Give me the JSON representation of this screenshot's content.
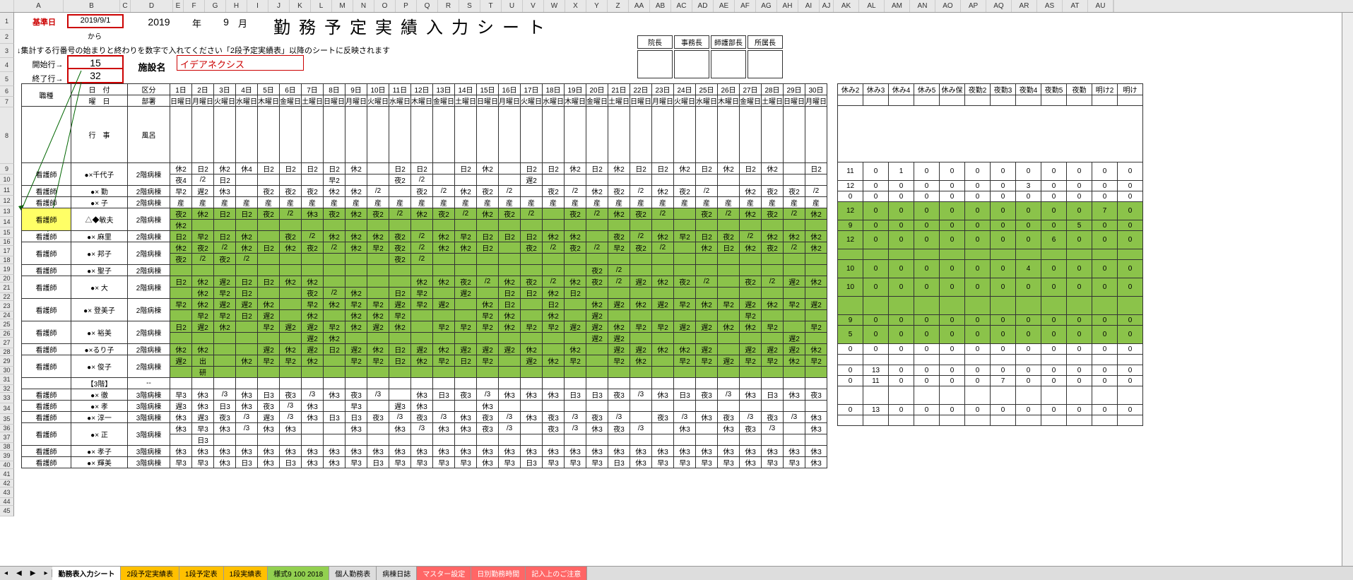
{
  "cols": [
    "A",
    "B",
    "C",
    "D",
    "E",
    "F",
    "G",
    "H",
    "I",
    "J",
    "K",
    "L",
    "M",
    "N",
    "O",
    "P",
    "Q",
    "R",
    "S",
    "T",
    "U",
    "V",
    "W",
    "X",
    "Y",
    "Z",
    "AA",
    "AB",
    "AC",
    "AD",
    "AE",
    "AF",
    "AG",
    "AH",
    "AI",
    "AJ",
    "AK",
    "AL",
    "AM",
    "AN",
    "AO",
    "AP",
    "AQ",
    "AR",
    "AS",
    "AT",
    "AU"
  ],
  "rows": [
    "1",
    "2",
    "3",
    "4",
    "5",
    "6",
    "7",
    "8",
    "9",
    "10",
    "11",
    "12",
    "13",
    "14",
    "15",
    "16",
    "17",
    "18",
    "19",
    "20",
    "21",
    "22",
    "23",
    "24",
    "25",
    "26",
    "27",
    "28",
    "29",
    "30",
    "31",
    "32",
    "33",
    "34",
    "35",
    "36",
    "37",
    "38",
    "39",
    "40",
    "41",
    "42",
    "43",
    "44",
    "45"
  ],
  "header": {
    "base_label": "基準日",
    "base_date": "2019/9/1",
    "year": "2019",
    "year_suf": "年",
    "month": "9",
    "month_suf": "月",
    "title": "勤務予定実績入力シート",
    "from": "から",
    "note": "↓集計する行番号の始まりと終わりを数字で入れてください「2段予定実績表」以降のシートに反映されます",
    "start_label": "開始行→",
    "start_val": "15",
    "end_label": "終了行→",
    "end_val": "32",
    "facility_label": "施設名",
    "facility_name": "イデアネクシス",
    "approvals": [
      "院長",
      "事務長",
      "師護部長",
      "所属長"
    ]
  },
  "gridhdr": {
    "job": "職種",
    "date": "日　付",
    "kubun": "区分",
    "dow": "曜　日",
    "busho": "部署",
    "event": "行　事",
    "bath": "風呂",
    "days": [
      "1日",
      "2日",
      "3日",
      "4日",
      "5日",
      "6日",
      "7日",
      "8日",
      "9日",
      "10日",
      "11日",
      "12日",
      "13日",
      "14日",
      "15日",
      "16日",
      "17日",
      "18日",
      "19日",
      "20日",
      "21日",
      "22日",
      "23日",
      "24日",
      "25日",
      "26日",
      "27日",
      "28日",
      "29日",
      "30日"
    ],
    "dows": [
      "日曜日",
      "月曜日",
      "火曜日",
      "水曜日",
      "木曜日",
      "金曜日",
      "土曜日",
      "日曜日",
      "月曜日",
      "火曜日",
      "水曜日",
      "木曜日",
      "金曜日",
      "土曜日",
      "日曜日",
      "月曜日",
      "火曜日",
      "水曜日",
      "木曜日",
      "金曜日",
      "土曜日",
      "日曜日",
      "月曜日",
      "火曜日",
      "水曜日",
      "木曜日",
      "金曜日",
      "土曜日",
      "日曜日",
      "月曜日"
    ]
  },
  "sumhdr": [
    "休み2",
    "休み3",
    "休み4",
    "休み5",
    "休み保",
    "夜勤2",
    "夜勤3",
    "夜勤4",
    "夜勤5",
    "夜勤",
    "明け2",
    "明け"
  ],
  "staff": [
    {
      "job": "看護師",
      "name": "●×千代子",
      "ward": "2階病棟",
      "g": 0,
      "r1": [
        "休2",
        "日2",
        "休2",
        "休4",
        "日2",
        "日2",
        "日2",
        "日2",
        "休2",
        "",
        "日2",
        "日2",
        "",
        "日2",
        "休2",
        "",
        "日2",
        "日2",
        "休2",
        "日2",
        "休2",
        "日2",
        "日2",
        "休2",
        "日2",
        "休2",
        "日2",
        "休2",
        "",
        "日2"
      ],
      "r2": [
        "夜4",
        "/2",
        "日2",
        "",
        "",
        "",
        "",
        "早2",
        "",
        "",
        "夜2",
        "/2",
        "",
        "",
        "",
        "",
        "遅2",
        "",
        "",
        "",
        "",
        "",
        "",
        "",
        "",
        "",
        "",
        "",
        "",
        ""
      ],
      "sum": [
        11,
        0,
        1,
        0,
        0,
        0,
        0,
        0,
        0,
        0,
        0,
        0
      ]
    },
    {
      "job": "看護師",
      "name": "●× 勤",
      "ward": "2階病棟",
      "g": 0,
      "r1": [
        "早2",
        "遅2",
        "休3",
        "",
        "夜2",
        "夜2",
        "夜2",
        "休2",
        "休2",
        "/2",
        "",
        "夜2",
        "/2",
        "休2",
        "夜2",
        "/2",
        "",
        "夜2",
        "/2",
        "休2",
        "夜2",
        "/2",
        "休2",
        "夜2",
        "/2",
        "",
        "休2",
        "夜2",
        "夜2",
        "/2"
      ],
      "r2": [],
      "sum": [
        12,
        0,
        0,
        0,
        0,
        0,
        0,
        3,
        0,
        0,
        0,
        0
      ]
    },
    {
      "job": "看護師",
      "name": "●× 子",
      "ward": "2階病棟",
      "g": 0,
      "r1": [
        "産",
        "産",
        "産",
        "産",
        "産",
        "産",
        "産",
        "産",
        "産",
        "産",
        "産",
        "産",
        "産",
        "産",
        "産",
        "産",
        "産",
        "産",
        "産",
        "産",
        "産",
        "産",
        "産",
        "産",
        "産",
        "産",
        "産",
        "産",
        "産",
        "産"
      ],
      "r2": [],
      "sum": [
        0,
        0,
        0,
        0,
        0,
        0,
        0,
        0,
        0,
        0,
        0,
        0
      ]
    },
    {
      "job": "看護師",
      "name": "△◆敏夫",
      "ward": "2階病棟",
      "g": 1,
      "hl": 1,
      "r1": [
        "夜2",
        "休2",
        "日2",
        "日2",
        "夜2",
        "/2",
        "休3",
        "夜2",
        "休2",
        "夜2",
        "/2",
        "休2",
        "夜2",
        "/2",
        "休2",
        "夜2",
        "/2",
        "",
        "夜2",
        "/2",
        "休2",
        "夜2",
        "/2",
        "",
        "夜2",
        "/2",
        "休2",
        "夜2",
        "/2",
        "休2"
      ],
      "r2": [
        "休2",
        "",
        "",
        "",
        "",
        "",
        "",
        "",
        "",
        "",
        "",
        "",
        "",
        "",
        "",
        "",
        "",
        "",
        "",
        "",
        "",
        "",
        "",
        "",
        "",
        "",
        "",
        "",
        "",
        ""
      ],
      "sum": [
        12,
        0,
        0,
        0,
        0,
        0,
        0,
        0,
        0,
        0,
        7,
        0
      ]
    },
    {
      "job": "看護師",
      "name": "●× 麻里",
      "ward": "2階病棟",
      "g": 1,
      "r1": [
        "日2",
        "早2",
        "日2",
        "休2",
        "",
        "夜2",
        "/2",
        "休2",
        "休2",
        "休2",
        "夜2",
        "/2",
        "休2",
        "早2",
        "日2",
        "日2",
        "日2",
        "休2",
        "休2",
        "",
        "夜2",
        "/2",
        "休2",
        "早2",
        "日2",
        "夜2",
        "/2",
        "休2",
        "休2",
        "休2"
      ],
      "r2": [],
      "sum": [
        9,
        0,
        0,
        0,
        0,
        0,
        0,
        0,
        0,
        5,
        0,
        0
      ]
    },
    {
      "job": "看護師",
      "name": "●× 邦子",
      "ward": "2階病棟",
      "g": 1,
      "r1": [
        "休2",
        "夜2",
        "/2",
        "休2",
        "日2",
        "休2",
        "夜2",
        "/2",
        "休2",
        "早2",
        "夜2",
        "/2",
        "休2",
        "休2",
        "日2",
        "",
        "夜2",
        "/2",
        "夜2",
        "/2",
        "早2",
        "夜2",
        "/2",
        "",
        "休2",
        "日2",
        "休2",
        "夜2",
        "/2",
        "休2"
      ],
      "r2": [
        "夜2",
        "/2",
        "夜2",
        "/2",
        "",
        "",
        "",
        "",
        "",
        "",
        "夜2",
        "/2",
        "",
        "",
        "",
        "",
        "",
        "",
        "",
        "",
        "",
        "",
        "",
        "",
        "",
        "",
        "",
        "",
        "",
        ""
      ],
      "sum": [
        12,
        0,
        0,
        0,
        0,
        0,
        0,
        0,
        6,
        0,
        0,
        0
      ]
    },
    {
      "job": "看護師",
      "name": "●× 聖子",
      "ward": "2階病棟",
      "g": 1,
      "r1": [
        "",
        "",
        "",
        "",
        "",
        "",
        "",
        "",
        "",
        "",
        "",
        "",
        "",
        "",
        "",
        "",
        "",
        "",
        "",
        "夜2",
        "/2",
        "",
        "",
        "",
        "",
        "",
        "",
        "",
        "",
        ""
      ],
      "r2": [],
      "sum": []
    },
    {
      "job": "看護師",
      "name": "●× 大",
      "ward": "2階病棟",
      "g": 1,
      "r1": [
        "日2",
        "休2",
        "遅2",
        "日2",
        "日2",
        "休2",
        "休2",
        "",
        "",
        "",
        "",
        "休2",
        "休2",
        "夜2",
        "/2",
        "休2",
        "夜2",
        "/2",
        "休2",
        "夜2",
        "/2",
        "遅2",
        "休2",
        "夜2",
        "/2",
        "",
        "夜2",
        "/2",
        "遅2",
        "休2"
      ],
      "r2": [
        "",
        "休2",
        "早2",
        "日2",
        "",
        "",
        "夜2",
        "/2",
        "休2",
        "",
        "日2",
        "早2",
        "",
        "遅2",
        "",
        "日2",
        "日2",
        "休2",
        "日2",
        "",
        "",
        "",
        "",
        "",
        "",
        "",
        "",
        "",
        "",
        ""
      ],
      "sum": [
        10,
        0,
        0,
        0,
        0,
        0,
        0,
        4,
        0,
        0,
        0,
        0
      ]
    },
    {
      "job": "看護師",
      "name": "●× 登美子",
      "ward": "2階病棟",
      "g": 1,
      "r1": [
        "早2",
        "休2",
        "遅2",
        "遅2",
        "休2",
        "",
        "早2",
        "休2",
        "早2",
        "早2",
        "遅2",
        "早2",
        "遅2",
        "",
        "休2",
        "日2",
        "",
        "日2",
        "",
        "休2",
        "遅2",
        "休2",
        "遅2",
        "早2",
        "休2",
        "早2",
        "遅2",
        "休2",
        "早2",
        "遅2"
      ],
      "r2": [
        "",
        "早2",
        "早2",
        "日2",
        "遅2",
        "",
        "休2",
        "",
        "休2",
        "休2",
        "早2",
        "",
        "",
        "",
        "早2",
        "休2",
        "",
        "休2",
        "",
        "遅2",
        "",
        "",
        "",
        "",
        "",
        "",
        "早2",
        "",
        "",
        ""
      ],
      "sum": [
        10,
        0,
        0,
        0,
        0,
        0,
        0,
        0,
        0,
        0,
        0,
        0
      ]
    },
    {
      "job": "看護師",
      "name": "●× 裕美",
      "ward": "2階病棟",
      "g": 1,
      "r1": [
        "日2",
        "遅2",
        "休2",
        "",
        "早2",
        "遅2",
        "遅2",
        "早2",
        "休2",
        "遅2",
        "休2",
        "",
        "早2",
        "早2",
        "早2",
        "休2",
        "早2",
        "早2",
        "遅2",
        "遅2",
        "休2",
        "早2",
        "早2",
        "遅2",
        "遅2",
        "休2",
        "休2",
        "早2",
        "",
        "早2"
      ],
      "r2": [
        "",
        "",
        "",
        "",
        "",
        "",
        "遅2",
        "休2",
        "",
        "",
        "",
        "",
        "",
        "",
        "",
        "",
        "",
        "",
        "",
        "遅2",
        "遅2",
        "",
        "",
        "",
        "",
        "",
        "",
        "",
        "遅2",
        ""
      ],
      "sum": []
    },
    {
      "job": "看護師",
      "name": "●×るり子",
      "ward": "2階病棟",
      "g": 1,
      "r1": [
        "休2",
        "休2",
        "",
        "",
        "遅2",
        "休2",
        "遅2",
        "日2",
        "遅2",
        "休2",
        "日2",
        "遅2",
        "休2",
        "遅2",
        "遅2",
        "遅2",
        "休2",
        "",
        "休2",
        "",
        "遅2",
        "遅2",
        "休2",
        "休2",
        "遅2",
        "",
        "遅2",
        "遅2",
        "遅2",
        "休2"
      ],
      "r2": [],
      "sum": [
        9,
        0,
        0,
        0,
        0,
        0,
        0,
        0,
        0,
        0,
        0,
        0
      ]
    },
    {
      "job": "看護師",
      "name": "●× 俊子",
      "ward": "2階病棟",
      "g": 1,
      "r1": [
        "遅2",
        "出",
        "",
        "休2",
        "早2",
        "早2",
        "休2",
        "",
        "早2",
        "早2",
        "日2",
        "休2",
        "早2",
        "日2",
        "早2",
        "",
        "遅2",
        "休2",
        "早2",
        "",
        "早2",
        "休2",
        "",
        "早2",
        "早2",
        "遅2",
        "早2",
        "早2",
        "休2",
        "早2"
      ],
      "r2": [
        "",
        "研",
        "",
        "",
        "",
        "",
        "",
        "",
        "",
        "",
        "",
        "",
        "",
        "",
        "",
        "",
        "",
        "",
        "",
        "",
        "",
        "",
        "",
        "",
        "",
        "",
        "",
        "",
        "",
        ""
      ],
      "sum": [
        5,
        0,
        0,
        0,
        0,
        0,
        0,
        0,
        0,
        0,
        0,
        0
      ]
    },
    {
      "job": "",
      "name": "【3階】",
      "ward": "--",
      "g": 0,
      "r1": [],
      "r2": [],
      "sum": [
        0,
        0,
        0,
        0,
        0,
        0,
        0,
        0,
        0,
        0,
        0,
        0
      ]
    },
    {
      "job": "看護師",
      "name": "●× 徹",
      "ward": "3階病棟",
      "g": 0,
      "r1": [
        "早3",
        "休3",
        "/3",
        "休3",
        "日3",
        "夜3",
        "/3",
        "休3",
        "夜3",
        "/3",
        "",
        "休3",
        "日3",
        "夜3",
        "/3",
        "休3",
        "休3",
        "休3",
        "日3",
        "日3",
        "夜3",
        "/3",
        "休3",
        "日3",
        "夜3",
        "/3",
        "休3",
        "日3",
        "休3",
        "夜3"
      ],
      "r2": [],
      "sum": []
    },
    {
      "job": "看護師",
      "name": "●× 孝",
      "ward": "3階病棟",
      "g": 0,
      "r1": [
        "遅3",
        "休3",
        "日3",
        "休3",
        "夜3",
        "/3",
        "休3",
        "",
        "早3",
        "",
        "遅3",
        "休3",
        "",
        "",
        "休3",
        "",
        "",
        "",
        "",
        "",
        "",
        "",
        "",
        "",
        "",
        "",
        "",
        "",
        "",
        ""
      ],
      "r2": [],
      "sum": [
        0,
        13,
        0,
        0,
        0,
        0,
        0,
        0,
        0,
        0,
        0,
        0
      ]
    },
    {
      "job": "看護師",
      "name": "●× 淳一",
      "ward": "3階病棟",
      "g": 0,
      "r1": [
        "休3",
        "遅3",
        "夜3",
        "/3",
        "遅3",
        "/3",
        "休3",
        "日3",
        "日3",
        "夜3",
        "/3",
        "夜3",
        "/3",
        "休3",
        "夜3",
        "/3",
        "休3",
        "夜3",
        "/3",
        "夜3",
        "/3",
        "",
        "夜3",
        "/3",
        "休3",
        "夜3",
        "/3",
        "夜3",
        "/3",
        "休3"
      ],
      "r2": [],
      "sum": [
        0,
        11,
        0,
        0,
        0,
        0,
        7,
        0,
        0,
        0,
        0,
        0
      ]
    },
    {
      "job": "看護師",
      "name": "●× 正",
      "ward": "3階病棟",
      "g": 0,
      "r1": [
        "休3",
        "早3",
        "休3",
        "/3",
        "休3",
        "休3",
        "",
        "",
        "休3",
        "",
        "休3",
        "/3",
        "休3",
        "休3",
        "夜3",
        "/3",
        "",
        "夜3",
        "/3",
        "休3",
        "夜3",
        "/3",
        "",
        "休3",
        "",
        "休3",
        "夜3",
        "/3",
        "",
        "休3"
      ],
      "r2": [
        "",
        "日3",
        "",
        "",
        "",
        "",
        "",
        "",
        "",
        "",
        "",
        "",
        "",
        "",
        "",
        "",
        "",
        "",
        "",
        "",
        "",
        "",
        "",
        "",
        "",
        "",
        "",
        "",
        "",
        ""
      ],
      "sum": []
    },
    {
      "job": "看護師",
      "name": "●× 孝子",
      "ward": "3階病棟",
      "g": 0,
      "r1": [
        "休3",
        "休3",
        "休3",
        "休3",
        "休3",
        "休3",
        "休3",
        "休3",
        "休3",
        "休3",
        "休3",
        "休3",
        "休3",
        "休3",
        "休3",
        "休3",
        "休3",
        "休3",
        "休3",
        "休3",
        "休3",
        "休3",
        "休3",
        "休3",
        "休3",
        "休3",
        "休3",
        "休3",
        "休3",
        "休3"
      ],
      "r2": [],
      "sum": [
        0,
        13,
        0,
        0,
        0,
        0,
        0,
        0,
        0,
        0,
        0,
        0
      ]
    },
    {
      "job": "看護師",
      "name": "●× 輝美",
      "ward": "3階病棟",
      "g": 0,
      "r1": [
        "早3",
        "早3",
        "休3",
        "日3",
        "休3",
        "日3",
        "休3",
        "休3",
        "早3",
        "日3",
        "早3",
        "早3",
        "早3",
        "早3",
        "休3",
        "早3",
        "日3",
        "早3",
        "早3",
        "早3",
        "日3",
        "休3",
        "早3",
        "早3",
        "早3",
        "早3",
        "休3",
        "早3",
        "早3",
        "休3"
      ],
      "r2": [],
      "sum": []
    }
  ],
  "tabs": [
    "勤務表入力シート",
    "2段予定実績表",
    "1段予定表",
    "1段実績表",
    "様式9 100 2018",
    "個人勤務表",
    "病棟日誌",
    "マスター設定",
    "日別勤務時間",
    "記入上のご注意"
  ]
}
